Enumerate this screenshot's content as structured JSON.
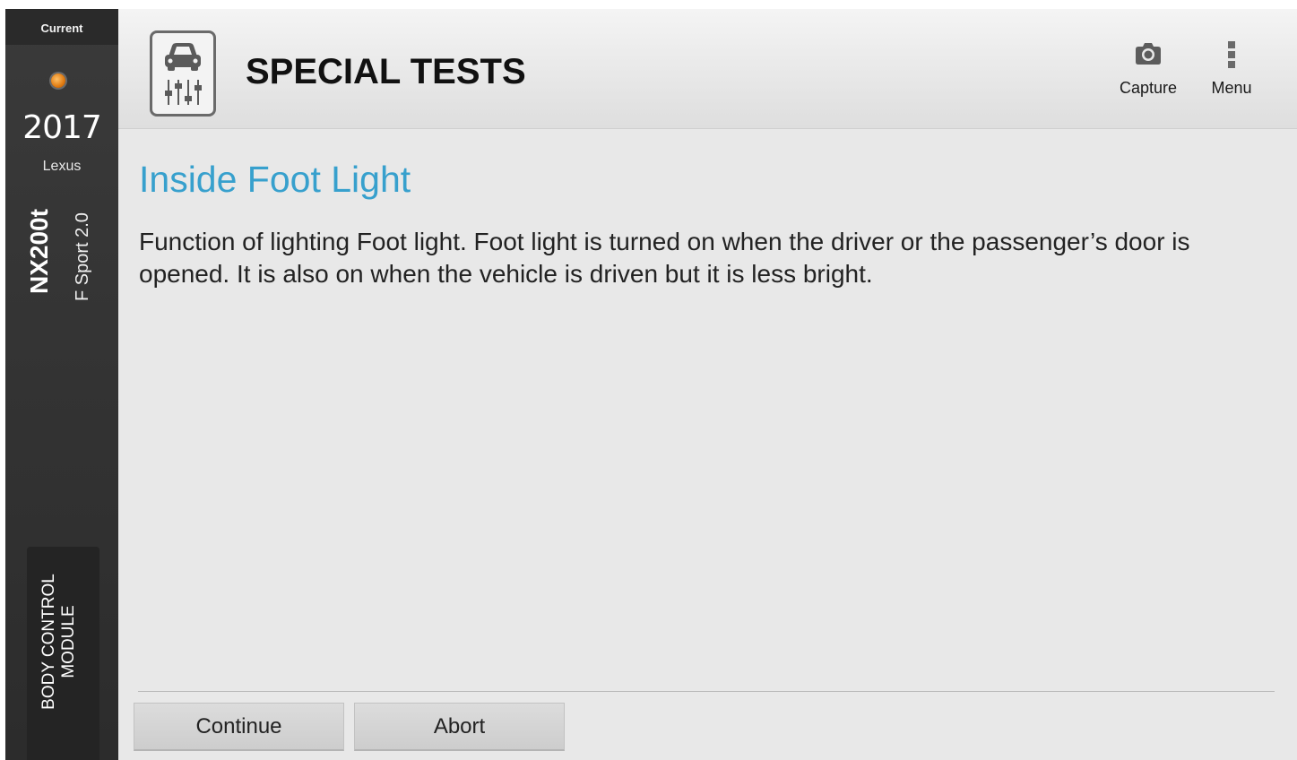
{
  "sidebar": {
    "current_label": "Current",
    "year": "2017",
    "make": "Lexus",
    "model": "NX200t",
    "trim": "F Sport 2.0",
    "module_label": "BODY CONTROL MODULE"
  },
  "header": {
    "title": "SPECIAL TESTS",
    "icon": "special-tests-icon",
    "capture_label": "Capture",
    "menu_label": "Menu"
  },
  "test": {
    "title": "Inside Foot Light",
    "description": "Function of lighting Foot light. Foot light is turned on when the driver or the passenger’s door is opened. It is also on when the vehicle is driven but it is less bright."
  },
  "actions": {
    "continue_label": "Continue",
    "abort_label": "Abort"
  },
  "colors": {
    "accent": "#37a0cd",
    "status_dot": "#e07a10",
    "sidebar_bg": "#333333"
  }
}
